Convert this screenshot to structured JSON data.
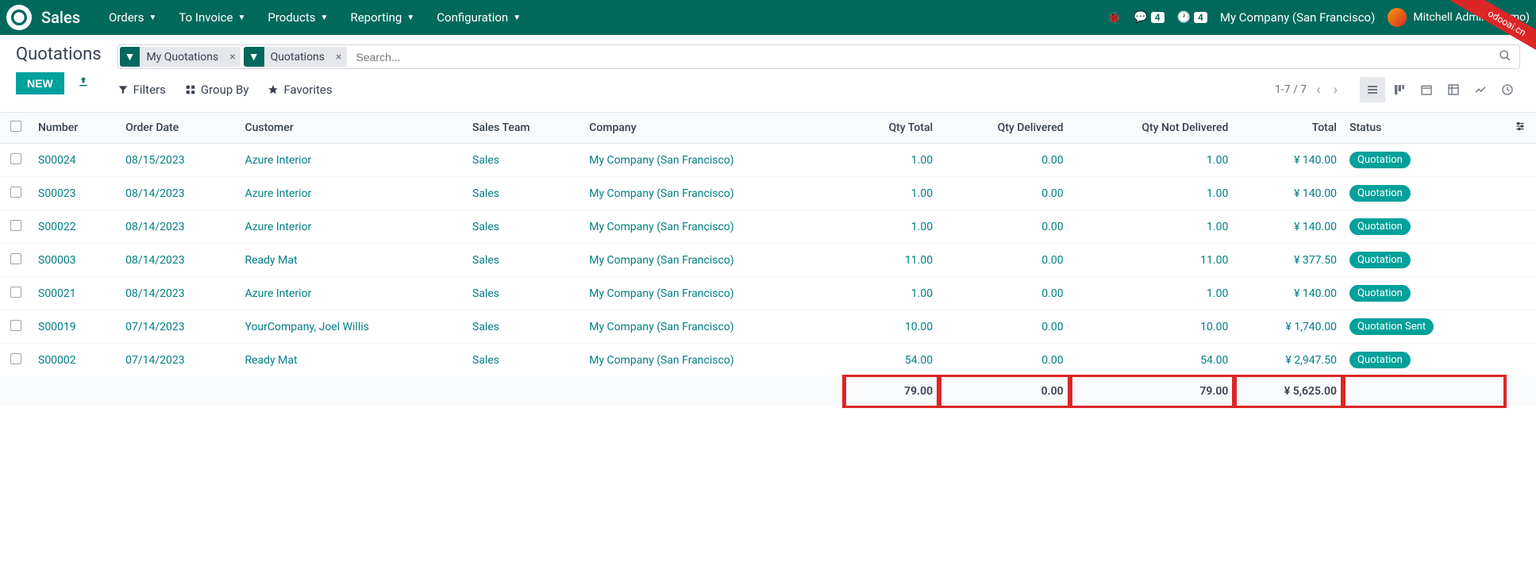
{
  "nav": {
    "app": "Sales",
    "items": [
      "Orders",
      "To Invoice",
      "Products",
      "Reporting",
      "Configuration"
    ],
    "msg_badge": "4",
    "clock_badge": "4",
    "company": "My Company (San Francisco)",
    "user": "Mitchell Admin",
    "demo": "(demo)",
    "ribbon": "odooai.cn"
  },
  "header": {
    "title": "Quotations",
    "new_btn": "NEW"
  },
  "search": {
    "chips": [
      {
        "label": "My Quotations"
      },
      {
        "label": "Quotations"
      }
    ],
    "placeholder": "Search..."
  },
  "toolbar": {
    "filters": "Filters",
    "groupby": "Group By",
    "favorites": "Favorites",
    "pager": "1-7 / 7"
  },
  "columns": {
    "number": "Number",
    "date": "Order Date",
    "customer": "Customer",
    "team": "Sales Team",
    "company": "Company",
    "qty_total": "Qty Total",
    "qty_delivered": "Qty Delivered",
    "qty_not_delivered": "Qty Not Delivered",
    "total": "Total",
    "status": "Status"
  },
  "rows": [
    {
      "number": "S00024",
      "date": "08/15/2023",
      "customer": "Azure Interior",
      "team": "Sales",
      "company": "My Company (San Francisco)",
      "qty_total": "1.00",
      "qty_delivered": "0.00",
      "qty_not_delivered": "1.00",
      "total": "¥ 140.00",
      "status": "Quotation"
    },
    {
      "number": "S00023",
      "date": "08/14/2023",
      "customer": "Azure Interior",
      "team": "Sales",
      "company": "My Company (San Francisco)",
      "qty_total": "1.00",
      "qty_delivered": "0.00",
      "qty_not_delivered": "1.00",
      "total": "¥ 140.00",
      "status": "Quotation"
    },
    {
      "number": "S00022",
      "date": "08/14/2023",
      "customer": "Azure Interior",
      "team": "Sales",
      "company": "My Company (San Francisco)",
      "qty_total": "1.00",
      "qty_delivered": "0.00",
      "qty_not_delivered": "1.00",
      "total": "¥ 140.00",
      "status": "Quotation"
    },
    {
      "number": "S00003",
      "date": "08/14/2023",
      "customer": "Ready Mat",
      "team": "Sales",
      "company": "My Company (San Francisco)",
      "qty_total": "11.00",
      "qty_delivered": "0.00",
      "qty_not_delivered": "11.00",
      "total": "¥ 377.50",
      "status": "Quotation"
    },
    {
      "number": "S00021",
      "date": "08/14/2023",
      "customer": "Azure Interior",
      "team": "Sales",
      "company": "My Company (San Francisco)",
      "qty_total": "1.00",
      "qty_delivered": "0.00",
      "qty_not_delivered": "1.00",
      "total": "¥ 140.00",
      "status": "Quotation"
    },
    {
      "number": "S00019",
      "date": "07/14/2023",
      "customer": "YourCompany, Joel Willis",
      "team": "Sales",
      "company": "My Company (San Francisco)",
      "qty_total": "10.00",
      "qty_delivered": "0.00",
      "qty_not_delivered": "10.00",
      "total": "¥ 1,740.00",
      "status": "Quotation Sent"
    },
    {
      "number": "S00002",
      "date": "07/14/2023",
      "customer": "Ready Mat",
      "team": "Sales",
      "company": "My Company (San Francisco)",
      "qty_total": "54.00",
      "qty_delivered": "0.00",
      "qty_not_delivered": "54.00",
      "total": "¥ 2,947.50",
      "status": "Quotation"
    }
  ],
  "totals": {
    "qty_total": "79.00",
    "qty_delivered": "0.00",
    "qty_not_delivered": "79.00",
    "total": "¥ 5,625.00"
  }
}
